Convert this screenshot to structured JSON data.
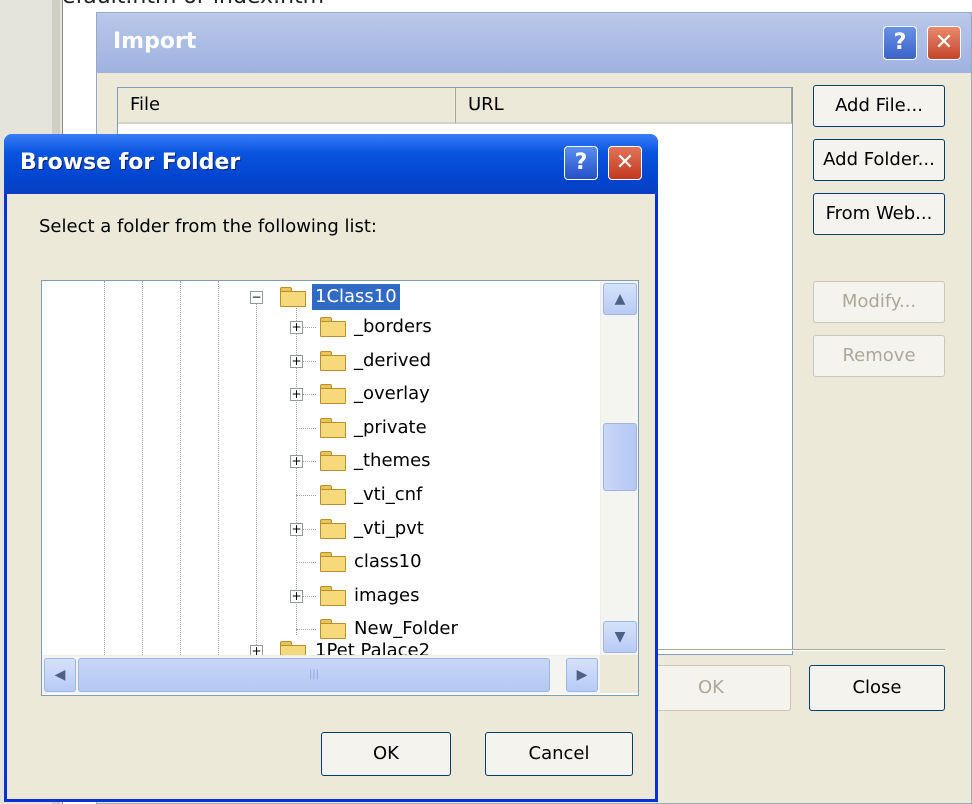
{
  "background": {
    "partial_text": "default.htm or index.htm"
  },
  "import_dialog": {
    "title": "Import",
    "columns": [
      "File",
      "URL"
    ],
    "buttons": {
      "add_file": "Add File...",
      "add_folder": "Add Folder...",
      "from_web": "From Web...",
      "modify": "Modify...",
      "remove": "Remove",
      "ok": "OK",
      "close": "Close"
    }
  },
  "browse_dialog": {
    "title": "Browse for Folder",
    "prompt": "Select a folder from the following list:",
    "selected_folder": "1Class10",
    "children": [
      {
        "label": "_borders",
        "expandable": true
      },
      {
        "label": "_derived",
        "expandable": true
      },
      {
        "label": "_overlay",
        "expandable": true
      },
      {
        "label": "_private",
        "expandable": false
      },
      {
        "label": "_themes",
        "expandable": true
      },
      {
        "label": "_vti_cnf",
        "expandable": false
      },
      {
        "label": "_vti_pvt",
        "expandable": true
      },
      {
        "label": "class10",
        "expandable": false
      },
      {
        "label": "images",
        "expandable": true
      },
      {
        "label": "New_Folder",
        "expandable": false
      }
    ],
    "next_folder": "1Pet Palace2",
    "buttons": {
      "ok": "OK",
      "cancel": "Cancel"
    }
  },
  "colors": {
    "xp_title_blue": "#0146d0",
    "selection": "#316ac5",
    "dialog_face": "#ece9d8",
    "folder_yellow": "#f6d97a"
  },
  "icons": [
    "help-icon",
    "close-icon",
    "folder-icon",
    "expand-plus-icon",
    "collapse-minus-icon",
    "scroll-up-arrow-icon",
    "scroll-down-arrow-icon",
    "scroll-left-arrow-icon",
    "scroll-right-arrow-icon"
  ]
}
